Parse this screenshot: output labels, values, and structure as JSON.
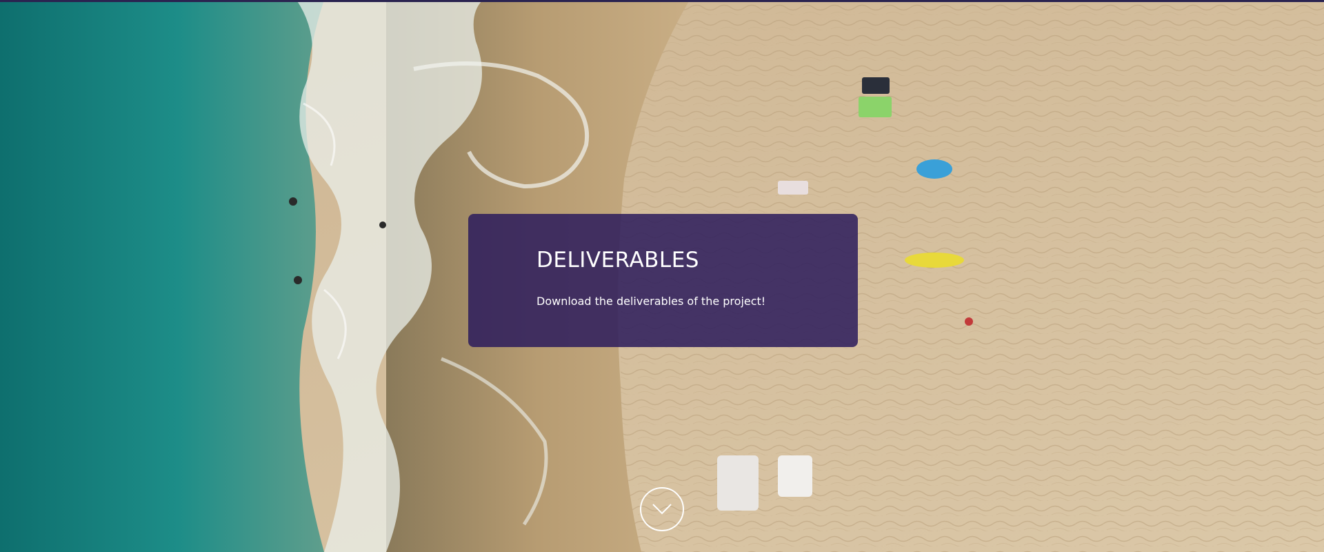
{
  "hero": {
    "title": "DELIVERABLES",
    "description": "Download the deliverables of the project!",
    "scroll_icon": "chevron-down-icon"
  },
  "colors": {
    "card_background": "#2c1c5c",
    "top_bar": "#2a2350",
    "sea": "#1f8a86",
    "sand": "#d8c4a3",
    "text": "#ffffff"
  }
}
